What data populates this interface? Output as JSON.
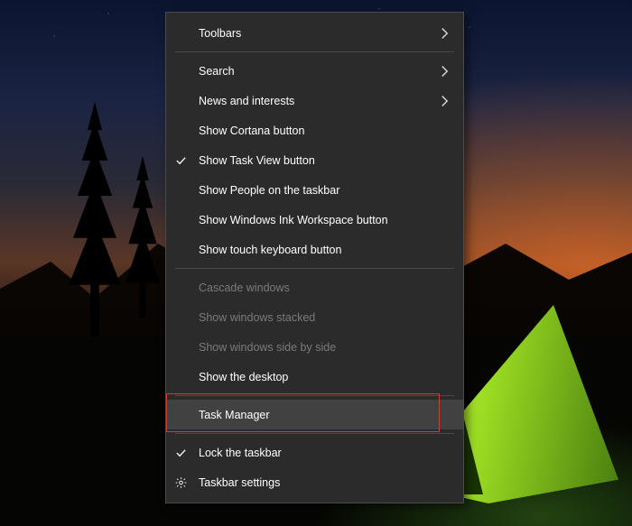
{
  "context_menu": {
    "items": [
      {
        "id": "toolbars",
        "label": "Toolbars",
        "submenu": true,
        "enabled": true,
        "checked": false,
        "icon": null
      },
      {
        "sep": true
      },
      {
        "id": "search",
        "label": "Search",
        "submenu": true,
        "enabled": true,
        "checked": false,
        "icon": null
      },
      {
        "id": "news",
        "label": "News and interests",
        "submenu": true,
        "enabled": true,
        "checked": false,
        "icon": null
      },
      {
        "id": "cortana",
        "label": "Show Cortana button",
        "submenu": false,
        "enabled": true,
        "checked": false,
        "icon": null
      },
      {
        "id": "taskview",
        "label": "Show Task View button",
        "submenu": false,
        "enabled": true,
        "checked": true,
        "icon": null
      },
      {
        "id": "people",
        "label": "Show People on the taskbar",
        "submenu": false,
        "enabled": true,
        "checked": false,
        "icon": null
      },
      {
        "id": "ink",
        "label": "Show Windows Ink Workspace button",
        "submenu": false,
        "enabled": true,
        "checked": false,
        "icon": null
      },
      {
        "id": "touchkb",
        "label": "Show touch keyboard button",
        "submenu": false,
        "enabled": true,
        "checked": false,
        "icon": null
      },
      {
        "sep": true
      },
      {
        "id": "cascade",
        "label": "Cascade windows",
        "submenu": false,
        "enabled": false,
        "checked": false,
        "icon": null
      },
      {
        "id": "stacked",
        "label": "Show windows stacked",
        "submenu": false,
        "enabled": false,
        "checked": false,
        "icon": null
      },
      {
        "id": "sidebyside",
        "label": "Show windows side by side",
        "submenu": false,
        "enabled": false,
        "checked": false,
        "icon": null
      },
      {
        "id": "showdesktop",
        "label": "Show the desktop",
        "submenu": false,
        "enabled": true,
        "checked": false,
        "icon": null
      },
      {
        "sep": true
      },
      {
        "id": "taskmanager",
        "label": "Task Manager",
        "submenu": false,
        "enabled": true,
        "checked": false,
        "icon": null,
        "hover": true,
        "annotated": true
      },
      {
        "sep": true
      },
      {
        "id": "locktaskbar",
        "label": "Lock the taskbar",
        "submenu": false,
        "enabled": true,
        "checked": true,
        "icon": null
      },
      {
        "id": "settings",
        "label": "Taskbar settings",
        "submenu": false,
        "enabled": true,
        "checked": false,
        "icon": "gear"
      }
    ]
  }
}
